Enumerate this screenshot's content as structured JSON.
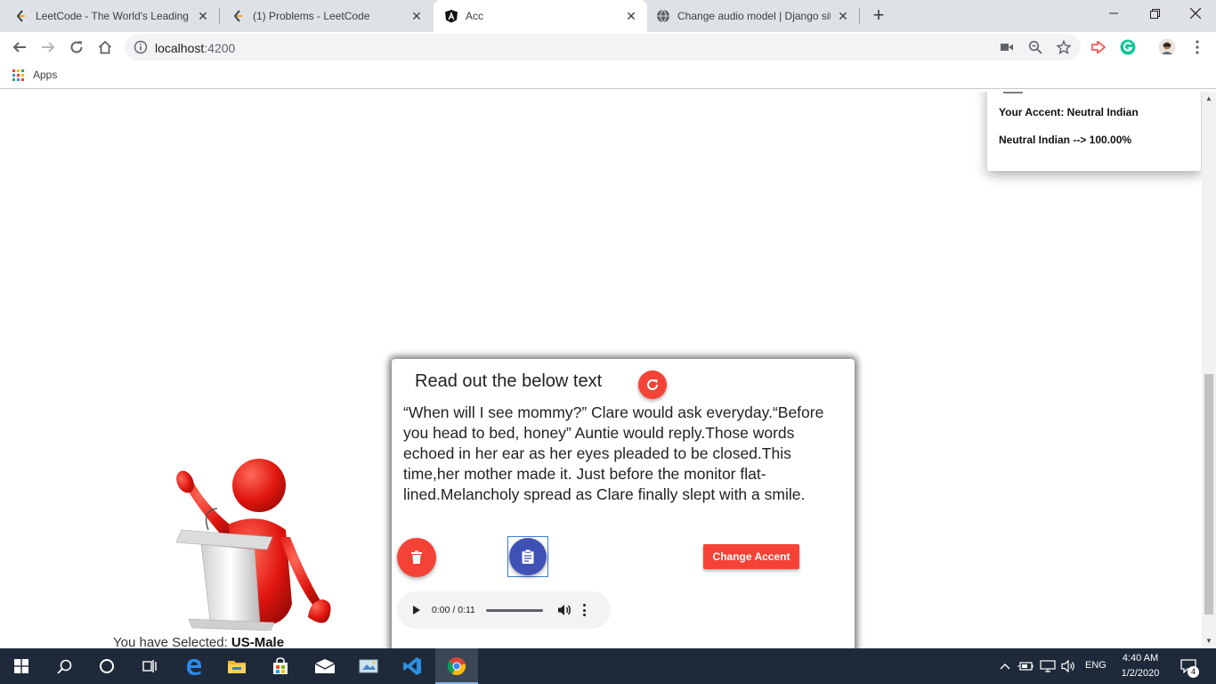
{
  "browser": {
    "tabs": [
      {
        "title": "LeetCode - The World's Leading",
        "icon": "leetcode-icon",
        "active": false
      },
      {
        "title": "(1) Problems - LeetCode",
        "icon": "leetcode-icon",
        "active": false
      },
      {
        "title": "Acc",
        "icon": "angular-icon",
        "active": true
      },
      {
        "title": "Change audio model | Django sit",
        "icon": "globe-icon",
        "active": false
      }
    ],
    "close_glyph": "✕",
    "new_tab_glyph": "+",
    "url_host": "localhost",
    "url_port": ":4200",
    "bookmarks": {
      "apps_label": "Apps"
    }
  },
  "result_card": {
    "accent_line": "Your Accent: Neutral Indian",
    "score_line": "Neutral Indian --> 100.00%"
  },
  "speaker": {
    "selected_prefix": "You have Selected: ",
    "selected_value": "US-Male"
  },
  "read_card": {
    "title": "Read out the below text",
    "passage": "“When will I see mommy?” Clare would ask everyday.“Before you head to bed, honey” Auntie would reply.Those words echoed in her ear as her eyes pleaded to be closed.This time,her mother made it. Just before the monitor flat-lined.Melancholy spread as Clare finally slept with a smile.",
    "change_accent_label": "Change Accent",
    "audio": {
      "time": "0:00 / 0:11",
      "progress": 0
    }
  },
  "taskbar": {
    "lang": "ENG",
    "time": "4:40 AM",
    "date": "1/2/2020",
    "notification_count": "4"
  },
  "colors": {
    "accent_red": "#f44336",
    "indigo": "#3f51b5",
    "taskbar": "#1e2a3a",
    "tabstrip": "#dee1e6"
  }
}
